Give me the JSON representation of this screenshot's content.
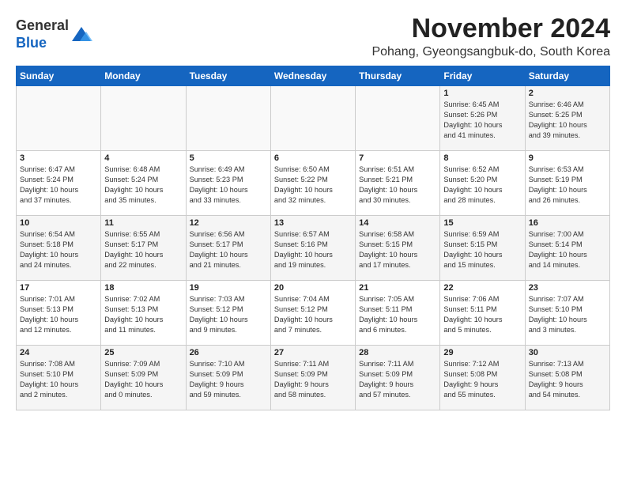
{
  "header": {
    "logo_general": "General",
    "logo_blue": "Blue",
    "month_title": "November 2024",
    "subtitle": "Pohang, Gyeongsangbuk-do, South Korea"
  },
  "weekdays": [
    "Sunday",
    "Monday",
    "Tuesday",
    "Wednesday",
    "Thursday",
    "Friday",
    "Saturday"
  ],
  "weeks": [
    [
      {
        "day": "",
        "info": ""
      },
      {
        "day": "",
        "info": ""
      },
      {
        "day": "",
        "info": ""
      },
      {
        "day": "",
        "info": ""
      },
      {
        "day": "",
        "info": ""
      },
      {
        "day": "1",
        "info": "Sunrise: 6:45 AM\nSunset: 5:26 PM\nDaylight: 10 hours\nand 41 minutes."
      },
      {
        "day": "2",
        "info": "Sunrise: 6:46 AM\nSunset: 5:25 PM\nDaylight: 10 hours\nand 39 minutes."
      }
    ],
    [
      {
        "day": "3",
        "info": "Sunrise: 6:47 AM\nSunset: 5:24 PM\nDaylight: 10 hours\nand 37 minutes."
      },
      {
        "day": "4",
        "info": "Sunrise: 6:48 AM\nSunset: 5:24 PM\nDaylight: 10 hours\nand 35 minutes."
      },
      {
        "day": "5",
        "info": "Sunrise: 6:49 AM\nSunset: 5:23 PM\nDaylight: 10 hours\nand 33 minutes."
      },
      {
        "day": "6",
        "info": "Sunrise: 6:50 AM\nSunset: 5:22 PM\nDaylight: 10 hours\nand 32 minutes."
      },
      {
        "day": "7",
        "info": "Sunrise: 6:51 AM\nSunset: 5:21 PM\nDaylight: 10 hours\nand 30 minutes."
      },
      {
        "day": "8",
        "info": "Sunrise: 6:52 AM\nSunset: 5:20 PM\nDaylight: 10 hours\nand 28 minutes."
      },
      {
        "day": "9",
        "info": "Sunrise: 6:53 AM\nSunset: 5:19 PM\nDaylight: 10 hours\nand 26 minutes."
      }
    ],
    [
      {
        "day": "10",
        "info": "Sunrise: 6:54 AM\nSunset: 5:18 PM\nDaylight: 10 hours\nand 24 minutes."
      },
      {
        "day": "11",
        "info": "Sunrise: 6:55 AM\nSunset: 5:17 PM\nDaylight: 10 hours\nand 22 minutes."
      },
      {
        "day": "12",
        "info": "Sunrise: 6:56 AM\nSunset: 5:17 PM\nDaylight: 10 hours\nand 21 minutes."
      },
      {
        "day": "13",
        "info": "Sunrise: 6:57 AM\nSunset: 5:16 PM\nDaylight: 10 hours\nand 19 minutes."
      },
      {
        "day": "14",
        "info": "Sunrise: 6:58 AM\nSunset: 5:15 PM\nDaylight: 10 hours\nand 17 minutes."
      },
      {
        "day": "15",
        "info": "Sunrise: 6:59 AM\nSunset: 5:15 PM\nDaylight: 10 hours\nand 15 minutes."
      },
      {
        "day": "16",
        "info": "Sunrise: 7:00 AM\nSunset: 5:14 PM\nDaylight: 10 hours\nand 14 minutes."
      }
    ],
    [
      {
        "day": "17",
        "info": "Sunrise: 7:01 AM\nSunset: 5:13 PM\nDaylight: 10 hours\nand 12 minutes."
      },
      {
        "day": "18",
        "info": "Sunrise: 7:02 AM\nSunset: 5:13 PM\nDaylight: 10 hours\nand 11 minutes."
      },
      {
        "day": "19",
        "info": "Sunrise: 7:03 AM\nSunset: 5:12 PM\nDaylight: 10 hours\nand 9 minutes."
      },
      {
        "day": "20",
        "info": "Sunrise: 7:04 AM\nSunset: 5:12 PM\nDaylight: 10 hours\nand 7 minutes."
      },
      {
        "day": "21",
        "info": "Sunrise: 7:05 AM\nSunset: 5:11 PM\nDaylight: 10 hours\nand 6 minutes."
      },
      {
        "day": "22",
        "info": "Sunrise: 7:06 AM\nSunset: 5:11 PM\nDaylight: 10 hours\nand 5 minutes."
      },
      {
        "day": "23",
        "info": "Sunrise: 7:07 AM\nSunset: 5:10 PM\nDaylight: 10 hours\nand 3 minutes."
      }
    ],
    [
      {
        "day": "24",
        "info": "Sunrise: 7:08 AM\nSunset: 5:10 PM\nDaylight: 10 hours\nand 2 minutes."
      },
      {
        "day": "25",
        "info": "Sunrise: 7:09 AM\nSunset: 5:09 PM\nDaylight: 10 hours\nand 0 minutes."
      },
      {
        "day": "26",
        "info": "Sunrise: 7:10 AM\nSunset: 5:09 PM\nDaylight: 9 hours\nand 59 minutes."
      },
      {
        "day": "27",
        "info": "Sunrise: 7:11 AM\nSunset: 5:09 PM\nDaylight: 9 hours\nand 58 minutes."
      },
      {
        "day": "28",
        "info": "Sunrise: 7:11 AM\nSunset: 5:09 PM\nDaylight: 9 hours\nand 57 minutes."
      },
      {
        "day": "29",
        "info": "Sunrise: 7:12 AM\nSunset: 5:08 PM\nDaylight: 9 hours\nand 55 minutes."
      },
      {
        "day": "30",
        "info": "Sunrise: 7:13 AM\nSunset: 5:08 PM\nDaylight: 9 hours\nand 54 minutes."
      }
    ]
  ]
}
